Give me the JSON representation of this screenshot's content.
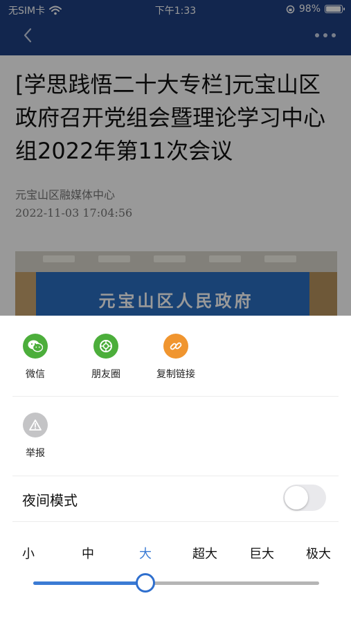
{
  "status_bar": {
    "carrier": "无SIM卡",
    "time": "下午1:33",
    "battery": "98%",
    "battery_level": 0.98
  },
  "nav": {
    "back_icon": "chevron-left-icon",
    "more_icon": "more-dots-icon"
  },
  "article": {
    "title": "[学思践悟二十大专栏]元宝山区政府召开党组会暨理论学习中心组2022年第11次会议",
    "source": "元宝山区融媒体中心",
    "datetime": "2022-11-03 17:04:56",
    "photo_banner_text": "元宝山区人民政府"
  },
  "share_sheet": {
    "items": [
      {
        "label": "微信",
        "icon": "wechat-icon",
        "color": "#4cae3b"
      },
      {
        "label": "朋友圈",
        "icon": "moments-icon",
        "color": "#4cae3b"
      },
      {
        "label": "复制链接",
        "icon": "link-icon",
        "color": "#f0952f"
      }
    ],
    "report": {
      "label": "举报",
      "icon": "warning-icon",
      "color": "#c4c4c6"
    },
    "night_mode": {
      "label": "夜间模式",
      "enabled": false
    },
    "font_sizes": {
      "options": [
        "小",
        "中",
        "大",
        "超大",
        "巨大",
        "极大"
      ],
      "selected": "大",
      "selected_index": 2
    }
  },
  "colors": {
    "header": "#1f4082",
    "accent": "#3b7bd4"
  }
}
